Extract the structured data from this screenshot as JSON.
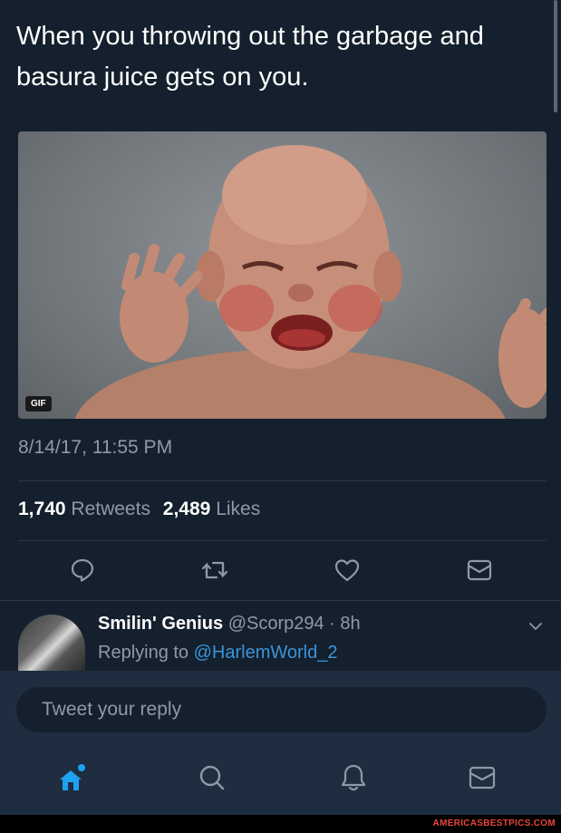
{
  "tweet": {
    "text": "When you throwing out the garbage and basura juice gets on you.",
    "media_badge": "GIF",
    "timestamp": "8/14/17, 11:55 PM"
  },
  "stats": {
    "retweets_count": "1,740",
    "retweets_label": "Retweets",
    "likes_count": "2,489",
    "likes_label": "Likes"
  },
  "actions": [
    {
      "icon": "reply-icon"
    },
    {
      "icon": "retweet-icon"
    },
    {
      "icon": "heart-icon"
    },
    {
      "icon": "direct-message-icon"
    }
  ],
  "reply": {
    "name": "Smilin' Genius",
    "handle": "@Scorp294",
    "time": "· 8h",
    "replying_prefix": "Replying to",
    "replying_to": "@HarlemWorld_2"
  },
  "composer": {
    "placeholder": "Tweet your reply"
  },
  "tabbar": [
    {
      "icon": "home-icon",
      "active": true
    },
    {
      "icon": "search-icon",
      "active": false
    },
    {
      "icon": "notifications-icon",
      "active": false
    },
    {
      "icon": "messages-icon",
      "active": false
    }
  ],
  "watermark": "AMERICASBESTPICS.COM",
  "colors": {
    "background": "#14202d",
    "accent": "#1da1f2",
    "muted": "#8e9aa6",
    "mention": "#3b94d9"
  }
}
